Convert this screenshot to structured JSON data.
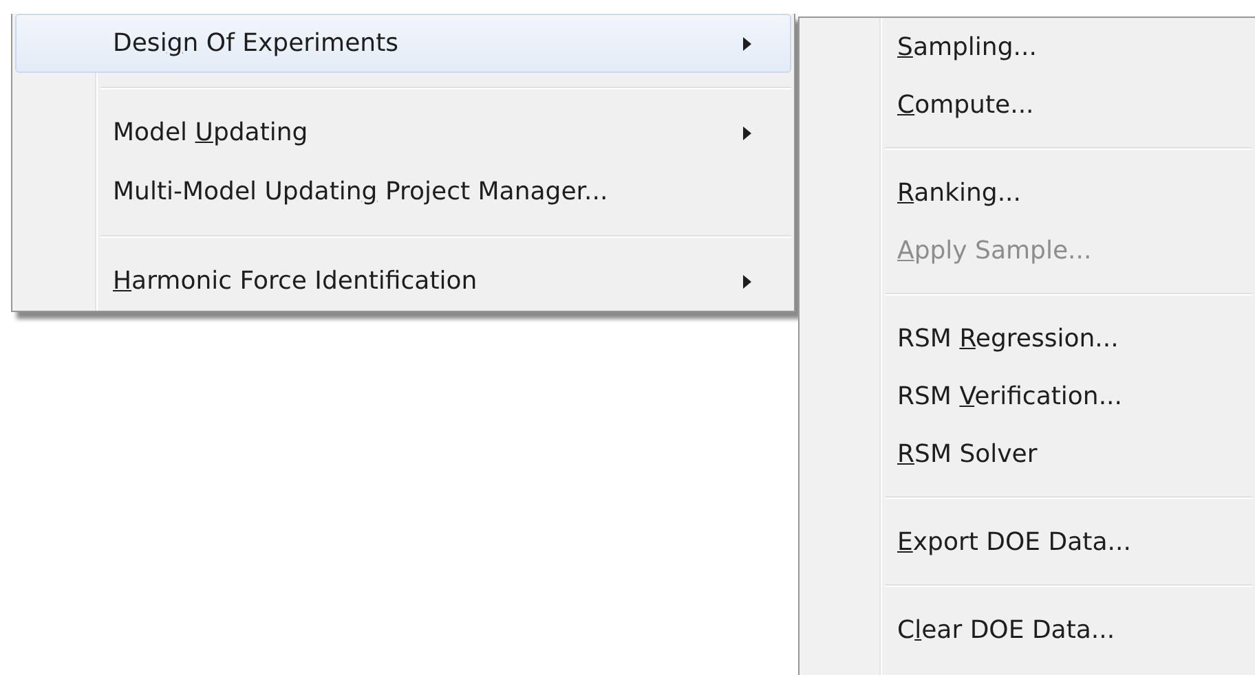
{
  "menu": {
    "items": [
      {
        "kind": "item",
        "label": [
          {
            "text": "Desi"
          },
          {
            "text": "g",
            "underlined": true
          },
          {
            "text": "n Of Experiments"
          }
        ],
        "submenu": true,
        "selected": true,
        "disabled": false
      },
      {
        "kind": "separator"
      },
      {
        "kind": "item",
        "label": [
          {
            "text": "Model "
          },
          {
            "text": "U",
            "underlined": true
          },
          {
            "text": "pdating"
          }
        ],
        "submenu": true,
        "selected": false,
        "disabled": false
      },
      {
        "kind": "item",
        "label": [
          {
            "text": "Multi-Model Updatin"
          },
          {
            "text": "g",
            "underlined": true
          },
          {
            "text": " Project Manager..."
          }
        ],
        "submenu": false,
        "selected": false,
        "disabled": false
      },
      {
        "kind": "separator"
      },
      {
        "kind": "item",
        "label": [
          {
            "text": "H",
            "underlined": true
          },
          {
            "text": "armonic Force Identification"
          }
        ],
        "submenu": true,
        "selected": false,
        "disabled": false
      }
    ]
  },
  "submenu": {
    "items": [
      {
        "kind": "item",
        "label": [
          {
            "text": "S",
            "underlined": true
          },
          {
            "text": "ampling..."
          }
        ],
        "submenu": false,
        "selected": false,
        "disabled": false
      },
      {
        "kind": "item",
        "label": [
          {
            "text": "C",
            "underlined": true
          },
          {
            "text": "ompute..."
          }
        ],
        "submenu": false,
        "selected": false,
        "disabled": false
      },
      {
        "kind": "separator"
      },
      {
        "kind": "item",
        "label": [
          {
            "text": "R",
            "underlined": true
          },
          {
            "text": "anking..."
          }
        ],
        "submenu": false,
        "selected": false,
        "disabled": false
      },
      {
        "kind": "item",
        "label": [
          {
            "text": "A",
            "underlined": true
          },
          {
            "text": "pply Sample..."
          }
        ],
        "submenu": false,
        "selected": false,
        "disabled": true
      },
      {
        "kind": "separator"
      },
      {
        "kind": "item",
        "label": [
          {
            "text": "RSM "
          },
          {
            "text": "R",
            "underlined": true
          },
          {
            "text": "egression..."
          }
        ],
        "submenu": false,
        "selected": false,
        "disabled": false
      },
      {
        "kind": "item",
        "label": [
          {
            "text": "RSM "
          },
          {
            "text": "V",
            "underlined": true
          },
          {
            "text": "erification..."
          }
        ],
        "submenu": false,
        "selected": false,
        "disabled": false
      },
      {
        "kind": "item",
        "label": [
          {
            "text": "R",
            "underlined": true
          },
          {
            "text": "SM Solver"
          }
        ],
        "submenu": false,
        "selected": false,
        "disabled": false
      },
      {
        "kind": "separator"
      },
      {
        "kind": "item",
        "label": [
          {
            "text": "E",
            "underlined": true
          },
          {
            "text": "xport DOE Data..."
          }
        ],
        "submenu": false,
        "selected": false,
        "disabled": false
      },
      {
        "kind": "separator"
      },
      {
        "kind": "item",
        "label": [
          {
            "text": "C"
          },
          {
            "text": "l",
            "underlined": true
          },
          {
            "text": "ear DOE Data..."
          }
        ],
        "submenu": false,
        "selected": false,
        "disabled": false
      }
    ]
  }
}
